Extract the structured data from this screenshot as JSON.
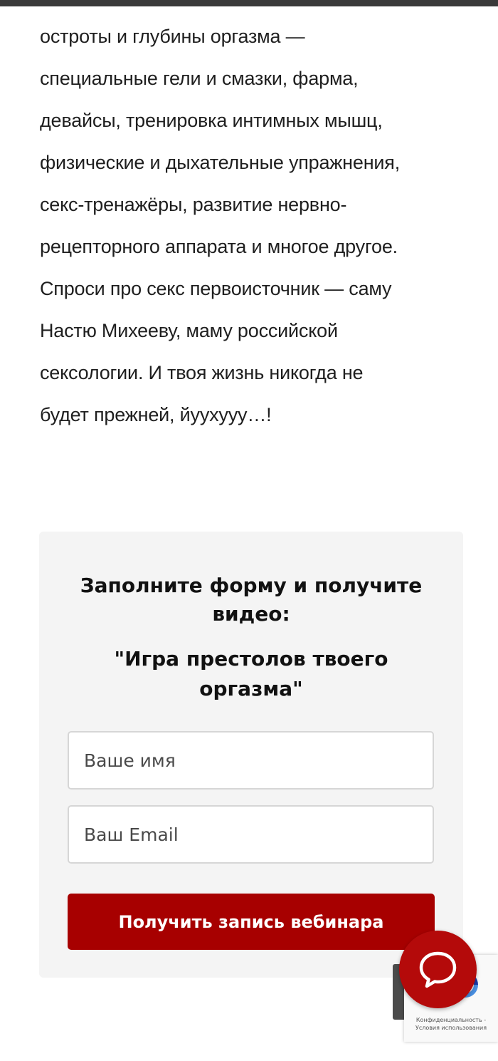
{
  "article": {
    "lines": [
      "остроты и глубины оргазма —",
      "специальные гели и смазки, фарма,",
      "девайсы, тренировка интимных мышц,",
      "физические и дыхательные упражнения,",
      "секс-тренажёры, развитие нервно-",
      "рецепторного аппарата и многое другое.",
      "Спроси про секс первоисточник — саму",
      "Настю Михееву, маму российской",
      "сексологии. И твоя жизнь никогда не",
      "будет прежней, йуухууу…!"
    ]
  },
  "form": {
    "title": "Заполните форму и получите видео:",
    "subtitle": "\"Игра престолов твоего оргазма\"",
    "name_placeholder": "Ваше имя",
    "email_placeholder": "Ваш Email",
    "submit_label": "Получить запись вебинара"
  },
  "recaptcha": {
    "line1": "Конфиденциальность -",
    "line2": "Условия использования"
  },
  "chat": {
    "icon": "chat-bubble-icon"
  },
  "colors": {
    "accent": "#a70000",
    "chat": "#b40a0a",
    "card_bg": "#f4f4f4"
  }
}
